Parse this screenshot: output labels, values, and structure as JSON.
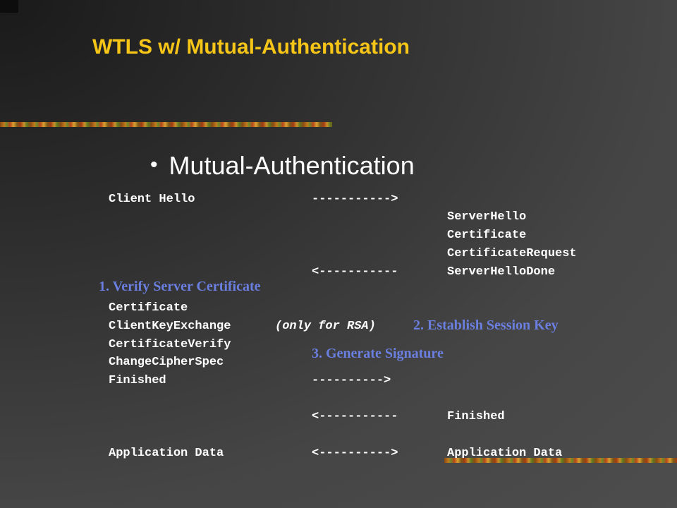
{
  "title": "WTLS w/ Mutual-Authentication",
  "bullet": "Mutual-Authentication",
  "arrows": {
    "right": "----------->",
    "left": "<-----------",
    "right_short": "---------->",
    "both": "<---------->"
  },
  "client": {
    "hello": "Client Hello",
    "certificate": "Certificate",
    "key_exchange": "ClientKeyExchange",
    "key_exchange_note": "(only for RSA)",
    "cert_verify": "CertificateVerify",
    "change_cipher": "ChangeCipherSpec",
    "finished": "Finished",
    "app_data": "Application Data"
  },
  "server": {
    "hello": "ServerHello",
    "certificate": "Certificate",
    "cert_request": "CertificateRequest",
    "hello_done": "ServerHelloDone",
    "finished": "Finished",
    "app_data": "Application Data"
  },
  "notes": {
    "step1": "1. Verify Server Certificate",
    "step2": "2. Establish Session Key",
    "step3": "3. Generate Signature"
  }
}
